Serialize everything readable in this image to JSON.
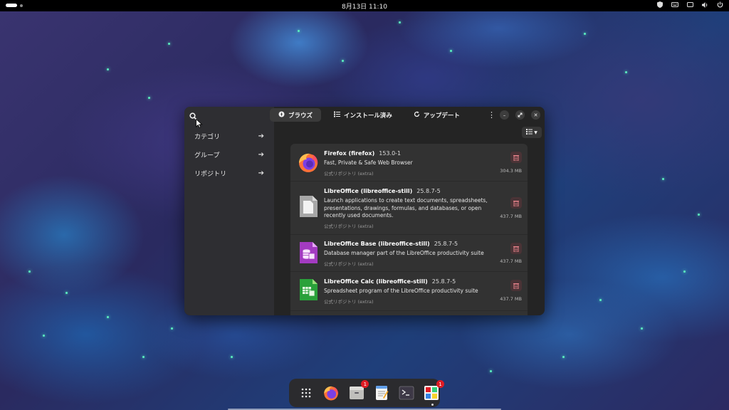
{
  "topbar": {
    "clock": "8月13日  11:10"
  },
  "sidebar": {
    "items": [
      {
        "label": "カテゴリ"
      },
      {
        "label": "グループ"
      },
      {
        "label": "リポジトリ"
      }
    ]
  },
  "tabs": [
    {
      "label": "ブラウズ",
      "icon": "compass-icon",
      "active": true
    },
    {
      "label": "インストール済み",
      "icon": "list-icon",
      "active": false
    },
    {
      "label": "アップデート",
      "icon": "refresh-icon",
      "active": false
    }
  ],
  "apps": [
    {
      "name": "Firefox (firefox)",
      "version": "153.0-1",
      "description": "Fast, Private & Safe Web Browser",
      "repo": "公式リポジトリ (extra)",
      "size": "304.3 MB",
      "icon": "firefox-icon"
    },
    {
      "name": "LibreOffice (libreoffice-still)",
      "version": "25.8.7-5",
      "description": "Launch applications to create text documents, spreadsheets, presentations, drawings, formulas, and databases, or open recently used documents.",
      "repo": "公式リポジトリ (extra)",
      "size": "437.7 MB",
      "icon": "libreoffice-icon"
    },
    {
      "name": "LibreOffice Base (libreoffice-still)",
      "version": "25.8.7-5",
      "description": "Database manager part of the LibreOffice productivity suite",
      "repo": "公式リポジトリ (extra)",
      "size": "437.7 MB",
      "icon": "libreoffice-base-icon"
    },
    {
      "name": "LibreOffice Calc (libreoffice-still)",
      "version": "25.8.7-5",
      "description": "Spreadsheet program of the LibreOffice productivity suite",
      "repo": "公式リポジトリ (extra)",
      "size": "437.7 MB",
      "icon": "libreoffice-calc-icon"
    }
  ],
  "dock": {
    "items": [
      {
        "name": "app-grid-icon"
      },
      {
        "name": "firefox-icon"
      },
      {
        "name": "file-manager-icon",
        "badge": "1"
      },
      {
        "name": "text-editor-icon"
      },
      {
        "name": "terminal-icon"
      },
      {
        "name": "software-icon",
        "badge": "1"
      }
    ]
  },
  "colors": {
    "accent_red": "#e01b24",
    "delete_icon": "#e8838b"
  }
}
